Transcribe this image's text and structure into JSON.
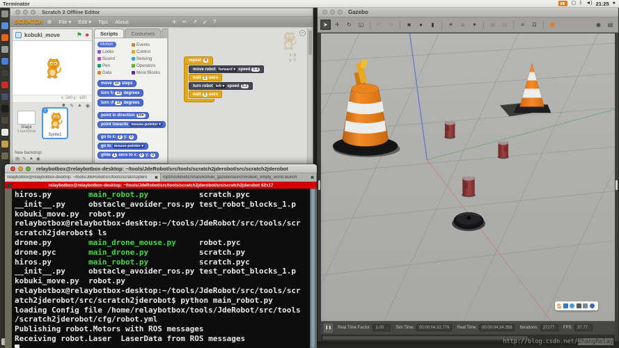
{
  "menubar": {
    "app_name": "Terminator",
    "time": "21:25"
  },
  "tray_icons": [
    "input-method-indicator",
    "display-icon",
    "bluetooth-icon",
    "volume-icon",
    "session-menu-icon"
  ],
  "dock": {
    "items": [
      {
        "name": "dash-home",
        "color": "#8f8f8d"
      },
      {
        "name": "files",
        "color": "#5a8fd6"
      },
      {
        "name": "firefox",
        "color": "#e8641a"
      },
      {
        "name": "screenshot-tool",
        "color": "#9a9a98"
      },
      {
        "name": "browser",
        "color": "#4a7fd6"
      },
      {
        "name": "camera-app",
        "color": "#3d3d3b"
      },
      {
        "name": "media-player",
        "color": "#c03030"
      },
      {
        "name": "system-settings",
        "color": "#44506a"
      },
      {
        "name": "opera",
        "color": "#1c1c1a"
      },
      {
        "name": "disk-utility",
        "color": "#50483c"
      },
      {
        "name": "text-editor",
        "color": "#e8e8e6"
      },
      {
        "name": "folder-bookmark",
        "color": "#c0a050"
      },
      {
        "name": "archive-tool",
        "color": "#6a6a52"
      },
      {
        "name": "trash",
        "color": "#d8d8d6",
        "bottom": true
      }
    ]
  },
  "scratch": {
    "window_title": "Scratch 2 Offline Editor",
    "logo": "SCRATCH",
    "globe_glyph": "⊕",
    "menus": [
      {
        "label": "File ▾"
      },
      {
        "label": "Edit ▾"
      },
      {
        "label": "Tips"
      },
      {
        "label": "About"
      }
    ],
    "toolbar_icons": [
      {
        "name": "duplicate-stamp-icon",
        "glyph": "✛"
      },
      {
        "name": "delete-icon",
        "glyph": "✂"
      },
      {
        "name": "grow-icon",
        "glyph": "↗"
      },
      {
        "name": "shrink-icon",
        "glyph": "↙"
      },
      {
        "name": "block-help-icon",
        "glyph": "?"
      }
    ],
    "sprite_name": "kobuki_move",
    "green_flag_glyph": "⚑",
    "stop_glyph": "●",
    "stage_coords": "x: 240  y: -180",
    "tabs": [
      {
        "label": "Scripts",
        "active": true
      },
      {
        "label": "Costumes",
        "active": false
      },
      {
        "label": "Sounds",
        "active": false
      }
    ],
    "categories": [
      {
        "label": "Motion",
        "color": "#4a6cd4",
        "selected": true
      },
      {
        "label": "Looks",
        "color": "#8a55d7",
        "selected": false
      },
      {
        "label": "Sound",
        "color": "#bb42c3",
        "selected": false
      },
      {
        "label": "Pen",
        "color": "#00a372",
        "selected": false
      },
      {
        "label": "Data",
        "color": "#ee7d16",
        "selected": false
      },
      {
        "label": "Events",
        "color": "#c88330",
        "selected": false
      },
      {
        "label": "Control",
        "color": "#e2a817",
        "selected": false
      },
      {
        "label": "Sensing",
        "color": "#2ca5e2",
        "selected": false
      },
      {
        "label": "Operators",
        "color": "#5cb712",
        "selected": false
      },
      {
        "label": "More Blocks",
        "color": "#632d99",
        "selected": false
      }
    ],
    "palette_blocks": [
      {
        "gap": false,
        "segs": [
          {
            "t": "move"
          },
          {
            "n": "10"
          },
          {
            "t": "steps"
          }
        ]
      },
      {
        "gap": false,
        "segs": [
          {
            "t": "turn ↻"
          },
          {
            "n": "15"
          },
          {
            "t": "degrees"
          }
        ]
      },
      {
        "gap": false,
        "segs": [
          {
            "t": "turn ↺"
          },
          {
            "n": "15"
          },
          {
            "t": "degrees"
          }
        ]
      },
      {
        "gap": true,
        "segs": [
          {
            "t": "point in direction"
          },
          {
            "n": "90▾"
          }
        ]
      },
      {
        "gap": false,
        "segs": [
          {
            "t": "point towards"
          },
          {
            "d": "mouse-pointer ▾"
          }
        ]
      },
      {
        "gap": true,
        "segs": [
          {
            "t": "go to x:"
          },
          {
            "n": "0"
          },
          {
            "t": "y:"
          },
          {
            "n": "0"
          }
        ]
      },
      {
        "gap": false,
        "segs": [
          {
            "t": "go to"
          },
          {
            "d": "mouse-pointer ▾"
          }
        ]
      },
      {
        "gap": false,
        "segs": [
          {
            "t": "glide"
          },
          {
            "n": "1"
          },
          {
            "t": "secs to x:"
          },
          {
            "n": "0"
          },
          {
            "t": "y:"
          },
          {
            "n": "0"
          }
        ]
      }
    ],
    "script": {
      "repeat_label": "repeat",
      "repeat_count": "4",
      "blocks": [
        {
          "type": "custom",
          "segs": [
            {
              "t": "move robot"
            },
            {
              "d": "forward ▾"
            },
            {
              "t": "speed"
            },
            {
              "n": "0.4"
            }
          ]
        },
        {
          "type": "control",
          "segs": [
            {
              "t": "wait"
            },
            {
              "n": "1"
            },
            {
              "t": "secs"
            }
          ]
        },
        {
          "type": "custom",
          "segs": [
            {
              "t": "turn robot"
            },
            {
              "d": "left ▾"
            },
            {
              "t": "speed"
            },
            {
              "n": "0.2"
            }
          ]
        },
        {
          "type": "control",
          "segs": [
            {
              "t": "wait"
            },
            {
              "n": "1"
            },
            {
              "t": "secs"
            }
          ]
        }
      ]
    },
    "script_info": {
      "x": "x: 6",
      "y": "y: 0"
    },
    "script_eq_glyph": "=",
    "stage_panel": {
      "stage_label": "Stage",
      "backdrop_count": "1 backdrop",
      "new_backdrop": "New backdrop:",
      "sprite_label": "Sprite1",
      "info_glyph": "i",
      "sprite_tool_icons": [
        {
          "name": "new-sprite-library-icon",
          "glyph": "☻"
        },
        {
          "name": "paint-new-sprite-icon",
          "glyph": "✎"
        },
        {
          "name": "upload-sprite-icon",
          "glyph": "▲"
        },
        {
          "name": "camera-sprite-icon",
          "glyph": "◉"
        }
      ],
      "backdrop_tool_icons": [
        {
          "name": "backdrop-library-icon",
          "glyph": "▤"
        },
        {
          "name": "paint-backdrop-icon",
          "glyph": "✎"
        },
        {
          "name": "upload-backdrop-icon",
          "glyph": "▲"
        },
        {
          "name": "camera-backdrop-icon",
          "glyph": "◉"
        }
      ]
    }
  },
  "terminal": {
    "title": "relaybotbox@relaybotbox-desktop: ~/tools/JdeRobot/src/tools/scratch2jderobot/src/scratch2jderobot",
    "tabs": [
      {
        "label": "relaybotbox@relaybotbox-desktop: ~/tools/JdeRobot/src/tools/scratch2jdero",
        "close": "✖",
        "active": true
      },
      {
        "label": "/opt/ros/kinetic/share/kobuki_gazebo/launch/kobuki_empty_world.launch",
        "close": "✖",
        "active": false
      }
    ],
    "terminator_title": "relaybotbox@relaybotbox-desktop: ~/tools/JdeRobot/src/tools/scratch2jderobot/src/scratch2jderobot 62x17",
    "lines": [
      [
        {
          "t": "hiros.py        "
        },
        {
          "t": "main_robot.py",
          "c": "g"
        },
        {
          "t": "           scratch.pyc"
        }
      ],
      [
        {
          "t": "__init__.py     obstacle_avoider_ros.py test_robot_blocks_1.p"
        }
      ],
      [
        {
          "t": "kobuki_move.py  robot.py"
        }
      ],
      [
        {
          "t": "relaybotbox@relaybotbox-desktop:~/tools/JdeRobot/src/tools/scr"
        }
      ],
      [
        {
          "t": "scratch2jderobot$ ls"
        }
      ],
      [
        {
          "t": "drone.py        "
        },
        {
          "t": "main_drone_mouse.py",
          "c": "g"
        },
        {
          "t": "     robot.pyc"
        }
      ],
      [
        {
          "t": "drone.pyc       "
        },
        {
          "t": "main_drone.py",
          "c": "g"
        },
        {
          "t": "           scratch.py"
        }
      ],
      [
        {
          "t": "hiros.py        "
        },
        {
          "t": "main_robot.py",
          "c": "g"
        },
        {
          "t": "           scratch.pyc"
        }
      ],
      [
        {
          "t": "__init__.py     obstacle_avoider_ros.py test_robot_blocks_1.p"
        }
      ],
      [
        {
          "t": "kobuki_move.py  robot.py"
        }
      ],
      [
        {
          "t": "relaybotbox@relaybotbox-desktop:~/tools/JdeRobot/src/tools/scr"
        }
      ],
      [
        {
          "t": "atch2jderobot/src/scratch2jderobot$ python main_robot.py"
        }
      ],
      [
        {
          "t": "loading Config file /home/relaybotbox/tools/JdeRobot/src/tools"
        }
      ],
      [
        {
          "t": "/scratch2jderobot/cfg/robot.yml"
        }
      ],
      [
        {
          "t": "Publishing robot.Motors with ROS messages"
        }
      ],
      [
        {
          "t": "Receiving robot.Laser  LaserData from ROS messages"
        }
      ],
      [
        {
          "cursor": true
        }
      ]
    ]
  },
  "gazebo": {
    "title": "Gazebo",
    "toolbar": [
      {
        "name": "select-tool",
        "glyph": "➤",
        "active": true
      },
      {
        "name": "translate-tool",
        "glyph": "✛"
      },
      {
        "name": "rotate-tool",
        "glyph": "↻"
      },
      {
        "name": "scale-tool",
        "glyph": "◱"
      },
      {
        "sep": true
      },
      {
        "name": "undo",
        "glyph": "↶",
        "disabled": true
      },
      {
        "name": "redo",
        "glyph": "↷",
        "disabled": true
      },
      {
        "sep": true
      },
      {
        "name": "box-shape",
        "glyph": "■"
      },
      {
        "name": "sphere-shape",
        "glyph": "●"
      },
      {
        "name": "cylinder-shape",
        "glyph": "▮"
      },
      {
        "sep": true
      },
      {
        "name": "point-light",
        "glyph": "☀"
      },
      {
        "name": "spot-light",
        "glyph": "☼"
      },
      {
        "name": "directional-light",
        "glyph": "✦"
      },
      {
        "sep": true
      },
      {
        "name": "copy",
        "glyph": "▣",
        "disabled": true
      },
      {
        "name": "paste",
        "glyph": "▤",
        "disabled": true
      },
      {
        "sep": true
      },
      {
        "name": "align",
        "glyph": "≡"
      },
      {
        "name": "snap",
        "glyph": "Ω"
      },
      {
        "sep": true
      },
      {
        "name": "insert-model",
        "glyph": "▣",
        "orange": true
      }
    ],
    "toolbar_right": [
      {
        "name": "camera-icon",
        "glyph": "◉"
      },
      {
        "name": "data-logger-icon",
        "glyph": "▤"
      }
    ],
    "pause_glyph": "❚❚",
    "status_fields": [
      {
        "label": "Real Time Factor:",
        "value": "1.00"
      },
      {
        "label": "Sim Time:",
        "value": "00:00:04:32.776"
      },
      {
        "label": "Real Time:",
        "value": "00:00:04:34.358"
      },
      {
        "label": "Iterations:",
        "value": "27277"
      },
      {
        "label": "FPS:",
        "value": "37.77"
      }
    ],
    "scene_objects": [
      "construction-barrel",
      "traffic-cone",
      "coke-can-1",
      "coke-can-2",
      "coke-can-3",
      "kobuki-robot"
    ]
  },
  "ime": {
    "logo": "S",
    "icons": [
      "chinese-mode-icon",
      "fullwidth-icon",
      "punctuation-icon",
      "keyboard-icon",
      "settings-icon"
    ]
  },
  "watermark": {
    "prefix": "http://blog.csdn.net/",
    "handle": "ZhangRelay"
  }
}
